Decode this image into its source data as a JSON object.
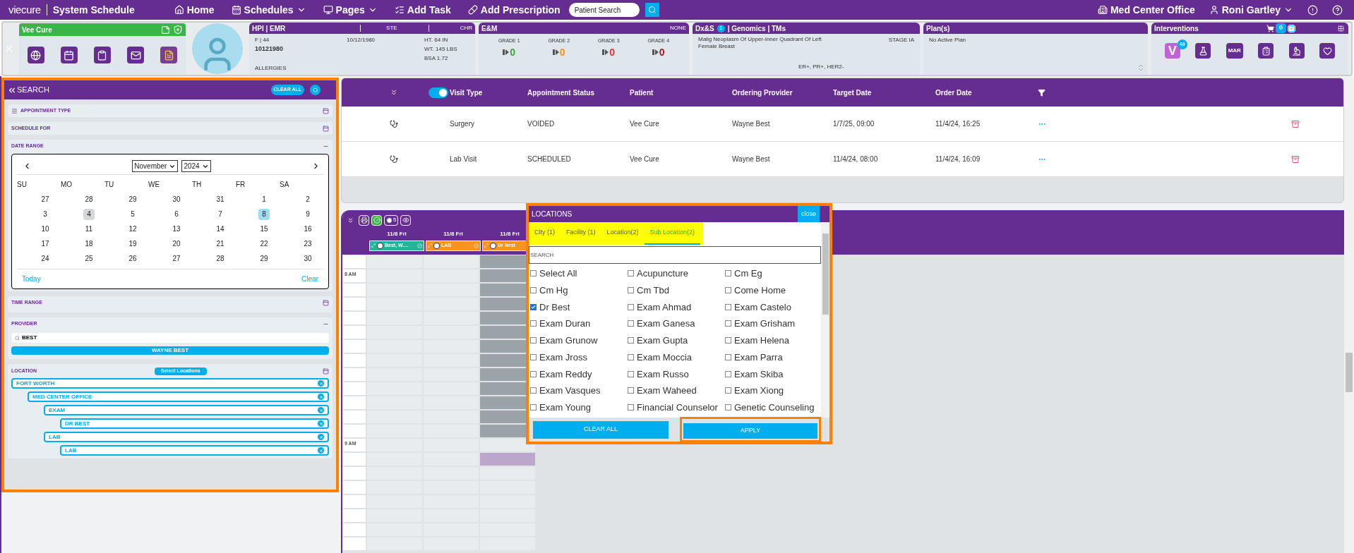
{
  "top_nav": {
    "logo": "viecure",
    "title": "System Schedule",
    "items": [
      {
        "label": "Home",
        "kind": "link"
      },
      {
        "label": "Schedules",
        "kind": "menu"
      },
      {
        "label": "Pages",
        "kind": "menu"
      },
      {
        "label": "Add Task",
        "kind": "link"
      },
      {
        "label": "Add Prescription",
        "kind": "link"
      }
    ],
    "search": {
      "placeholder": "Patient Search"
    },
    "office": "Med Center Office",
    "user": "Roni Gartley"
  },
  "patient": {
    "name": "Vee Cure"
  },
  "hpi": {
    "title": "HPI | EMR",
    "ste": "STE",
    "chr": "CHR",
    "sex_age": "F | 44",
    "mrn": "10121980",
    "dob": "10/12/1980",
    "height": "HT. 64 IN",
    "weight": "WT. 145 LBS",
    "bsa": "BSA 1.72",
    "allergies": "ALLERGIES"
  },
  "em": {
    "title": "E&M",
    "status": "NONE",
    "grades": [
      {
        "label": "GRADE 1",
        "value": "0",
        "color": "#3aa63a"
      },
      {
        "label": "GRADE 2",
        "value": "0",
        "color": "#f7931e"
      },
      {
        "label": "GRADE 3",
        "value": "0",
        "color": "#e8312f"
      },
      {
        "label": "GRADE 4",
        "value": "0",
        "color": "#b0121b"
      }
    ]
  },
  "dx": {
    "title": "Dx&S",
    "count": "1",
    "tabs": "| Genomics | TMs",
    "diagnosis": "Malig Neoplasm Of Upper-Inner Quadrant Of Left Female Breast",
    "stage": "STAGE IA",
    "markers": "ER+, PR+, HER2-"
  },
  "plans": {
    "title": "Plan(s)",
    "text": "No Active Plan"
  },
  "interventions": {
    "title": "Interventions",
    "cart_count": "0",
    "v_label": "V",
    "v_badge": "46",
    "mar_label": "MAR"
  },
  "search_panel": {
    "title": "SEARCH",
    "clear": "CLEAR ALL",
    "appointment_type": {
      "label": "APPOINTMENT TYPE",
      "expanded": false
    },
    "schedule_for": {
      "label": "SCHEDULE FOR",
      "expanded": false
    },
    "date_range": {
      "label": "DATE RANGE",
      "expanded": true,
      "month": "November",
      "year": "2024",
      "weekdays": [
        "SU",
        "MO",
        "TU",
        "WE",
        "TH",
        "FR",
        "SA"
      ],
      "weeks": [
        [
          {
            "day": "27",
            "selected": false,
            "today": false
          },
          {
            "day": "28",
            "selected": false,
            "today": false
          },
          {
            "day": "29",
            "selected": false,
            "today": false
          },
          {
            "day": "30",
            "selected": false,
            "today": false
          },
          {
            "day": "31",
            "selected": false,
            "today": false
          },
          {
            "day": "1",
            "selected": false,
            "today": false
          },
          {
            "day": "2",
            "selected": false,
            "today": false
          }
        ],
        [
          {
            "day": "3",
            "selected": false,
            "today": false
          },
          {
            "day": "4",
            "selected": false,
            "today": true
          },
          {
            "day": "5",
            "selected": false,
            "today": false
          },
          {
            "day": "6",
            "selected": false,
            "today": false
          },
          {
            "day": "7",
            "selected": false,
            "today": false
          },
          {
            "day": "8",
            "selected": true,
            "today": false
          },
          {
            "day": "9",
            "selected": false,
            "today": false
          }
        ],
        [
          {
            "day": "10",
            "selected": false,
            "today": false
          },
          {
            "day": "11",
            "selected": false,
            "today": false
          },
          {
            "day": "12",
            "selected": false,
            "today": false
          },
          {
            "day": "13",
            "selected": false,
            "today": false
          },
          {
            "day": "14",
            "selected": false,
            "today": false
          },
          {
            "day": "15",
            "selected": false,
            "today": false
          },
          {
            "day": "16",
            "selected": false,
            "today": false
          }
        ],
        [
          {
            "day": "17",
            "selected": false,
            "today": false
          },
          {
            "day": "18",
            "selected": false,
            "today": false
          },
          {
            "day": "19",
            "selected": false,
            "today": false
          },
          {
            "day": "20",
            "selected": false,
            "today": false
          },
          {
            "day": "21",
            "selected": false,
            "today": false
          },
          {
            "day": "22",
            "selected": false,
            "today": false
          },
          {
            "day": "23",
            "selected": false,
            "today": false
          }
        ],
        [
          {
            "day": "24",
            "selected": false,
            "today": false
          },
          {
            "day": "25",
            "selected": false,
            "today": false
          },
          {
            "day": "26",
            "selected": false,
            "today": false
          },
          {
            "day": "27",
            "selected": false,
            "today": false
          },
          {
            "day": "28",
            "selected": false,
            "today": false
          },
          {
            "day": "29",
            "selected": false,
            "today": false
          },
          {
            "day": "30",
            "selected": false,
            "today": false
          }
        ]
      ],
      "today_label": "Today",
      "clear_label": "Clear"
    },
    "time_range": {
      "label": "TIME RANGE",
      "expanded": false
    },
    "provider": {
      "label": "PROVIDER",
      "expanded": true,
      "query": "BEST",
      "result": "WAYNE BEST"
    },
    "location": {
      "label": "LOCATION",
      "expanded": false,
      "select": "Select Locations",
      "tree": [
        {
          "label": "FORT WORTH",
          "children": [
            {
              "label": "MED CENTER OFFICE",
              "children": [
                {
                  "label": "EXAM",
                  "children": [
                    {
                      "label": "DR BEST"
                    }
                  ]
                },
                {
                  "label": "LAB",
                  "children": [
                    {
                      "label": "LAB"
                    }
                  ]
                }
              ]
            }
          ]
        }
      ]
    }
  },
  "appointments": {
    "visit_type_on": true,
    "columns": [
      "Visit Type",
      "Appointment Status",
      "Patient",
      "Ordering Provider",
      "Target Date",
      "Order Date"
    ],
    "rows": [
      [
        "Surgery",
        "VOIDED",
        "Vee Cure",
        "Wayne Best",
        "1/7/25, 09:00",
        "11/4/24, 16:25"
      ],
      [
        "Lab Visit",
        "SCHEDULED",
        "Vee Cure",
        "Wayne Best",
        "11/4/24, 08:00",
        "11/4/24, 16:09"
      ]
    ]
  },
  "schedule": {
    "clock_badge": "5",
    "columns": [
      {
        "date": "11/8 Fri",
        "name": "Best, W....",
        "color": "#26b39a"
      },
      {
        "date": "11/8 Fri",
        "name": "LAB",
        "color": "#f7931e"
      },
      {
        "date": "11/8 Fri",
        "name": "Dr Best",
        "color": "#f7931e"
      }
    ],
    "rows": [
      {
        "cells": [
          {
            "kind": "open"
          },
          {
            "kind": "open"
          },
          {
            "kind": "blocked"
          }
        ]
      },
      {
        "time": "8 AM",
        "cells": [
          {
            "kind": "open"
          },
          {
            "kind": "open"
          },
          {
            "kind": "blocked"
          }
        ]
      },
      {
        "cells": [
          {
            "kind": "open"
          },
          {
            "kind": "open"
          },
          {
            "kind": "blocked"
          }
        ]
      },
      {
        "cells": [
          {
            "kind": "open"
          },
          {
            "kind": "open"
          },
          {
            "kind": "blocked"
          }
        ]
      },
      {
        "cells": [
          {
            "kind": "open"
          },
          {
            "kind": "open"
          },
          {
            "kind": "blocked"
          }
        ]
      },
      {
        "cells": [
          {
            "kind": "open"
          },
          {
            "kind": "open"
          },
          {
            "kind": "blocked"
          }
        ]
      },
      {
        "cells": [
          {
            "kind": "open"
          },
          {
            "kind": "open"
          },
          {
            "kind": "blocked"
          }
        ]
      },
      {
        "cells": [
          {
            "kind": "open"
          },
          {
            "kind": "open"
          },
          {
            "kind": "blocked"
          }
        ]
      },
      {
        "cells": [
          {
            "kind": "open"
          },
          {
            "kind": "open"
          },
          {
            "kind": "blocked"
          }
        ]
      },
      {
        "cells": [
          {
            "kind": "open"
          },
          {
            "kind": "open"
          },
          {
            "kind": "blocked"
          }
        ]
      },
      {
        "cells": [
          {
            "kind": "open"
          },
          {
            "kind": "open"
          },
          {
            "kind": "blocked"
          }
        ]
      },
      {
        "cells": [
          {
            "kind": "open"
          },
          {
            "kind": "open"
          },
          {
            "kind": "blocked"
          }
        ]
      },
      {
        "cells": [
          {
            "kind": "open"
          },
          {
            "kind": "open"
          },
          {
            "kind": "blocked"
          }
        ]
      },
      {
        "time": "9 AM",
        "cells": [
          {
            "kind": "open"
          },
          {
            "kind": "open"
          },
          {
            "kind": "open"
          }
        ]
      },
      {
        "cells": [
          {
            "kind": "open"
          },
          {
            "kind": "open"
          },
          {
            "kind": "booked"
          }
        ]
      },
      {
        "cells": [
          {
            "kind": "open"
          },
          {
            "kind": "open"
          },
          {
            "kind": "open"
          }
        ]
      },
      {
        "cells": [
          {
            "kind": "open"
          },
          {
            "kind": "open"
          },
          {
            "kind": "open"
          }
        ]
      },
      {
        "cells": [
          {
            "kind": "open"
          },
          {
            "kind": "open"
          },
          {
            "kind": "open"
          }
        ]
      },
      {
        "cells": [
          {
            "kind": "open"
          },
          {
            "kind": "open"
          },
          {
            "kind": "open"
          }
        ]
      },
      {
        "cells": [
          {
            "kind": "open"
          },
          {
            "kind": "open"
          },
          {
            "kind": "open"
          }
        ]
      },
      {
        "cells": [
          {
            "kind": "open"
          },
          {
            "kind": "open"
          },
          {
            "kind": "open"
          }
        ]
      }
    ]
  },
  "locations": {
    "title": "LOCATIONS",
    "close": "close",
    "tabs": [
      {
        "label": "City (1)",
        "selected": false
      },
      {
        "label": "Facility (1)",
        "selected": false
      },
      {
        "label": "Location(2)",
        "selected": false
      },
      {
        "label": "Sub Location(2)",
        "selected": true
      }
    ],
    "search_placeholder": "SEARCH",
    "options": [
      {
        "label": "Select All",
        "checked": false
      },
      {
        "label": "Acupuncture",
        "checked": false
      },
      {
        "label": "Cm Eg",
        "checked": false
      },
      {
        "label": "Cm Hg",
        "checked": false
      },
      {
        "label": "Cm Tbd",
        "checked": false
      },
      {
        "label": "Come Home",
        "checked": false
      },
      {
        "label": "Dr Best",
        "checked": true
      },
      {
        "label": "Exam Ahmad",
        "checked": false
      },
      {
        "label": "Exam Castelo",
        "checked": false
      },
      {
        "label": "Exam Duran",
        "checked": false
      },
      {
        "label": "Exam Ganesa",
        "checked": false
      },
      {
        "label": "Exam Grisham",
        "checked": false
      },
      {
        "label": "Exam Grunow",
        "checked": false
      },
      {
        "label": "Exam Gupta",
        "checked": false
      },
      {
        "label": "Exam Helena",
        "checked": false
      },
      {
        "label": "Exam Jross",
        "checked": false
      },
      {
        "label": "Exam Moccia",
        "checked": false
      },
      {
        "label": "Exam Parra",
        "checked": false
      },
      {
        "label": "Exam Reddy",
        "checked": false
      },
      {
        "label": "Exam Russo",
        "checked": false
      },
      {
        "label": "Exam Skiba",
        "checked": false
      },
      {
        "label": "Exam Vasques",
        "checked": false
      },
      {
        "label": "Exam Waheed",
        "checked": false
      },
      {
        "label": "Exam Xiong",
        "checked": false
      },
      {
        "label": "Exam Young",
        "checked": false
      },
      {
        "label": "Financial Counselor",
        "checked": false
      },
      {
        "label": "Genetic Counseling",
        "checked": false
      }
    ],
    "clear": "CLEAR ALL",
    "apply": "APPLY"
  }
}
